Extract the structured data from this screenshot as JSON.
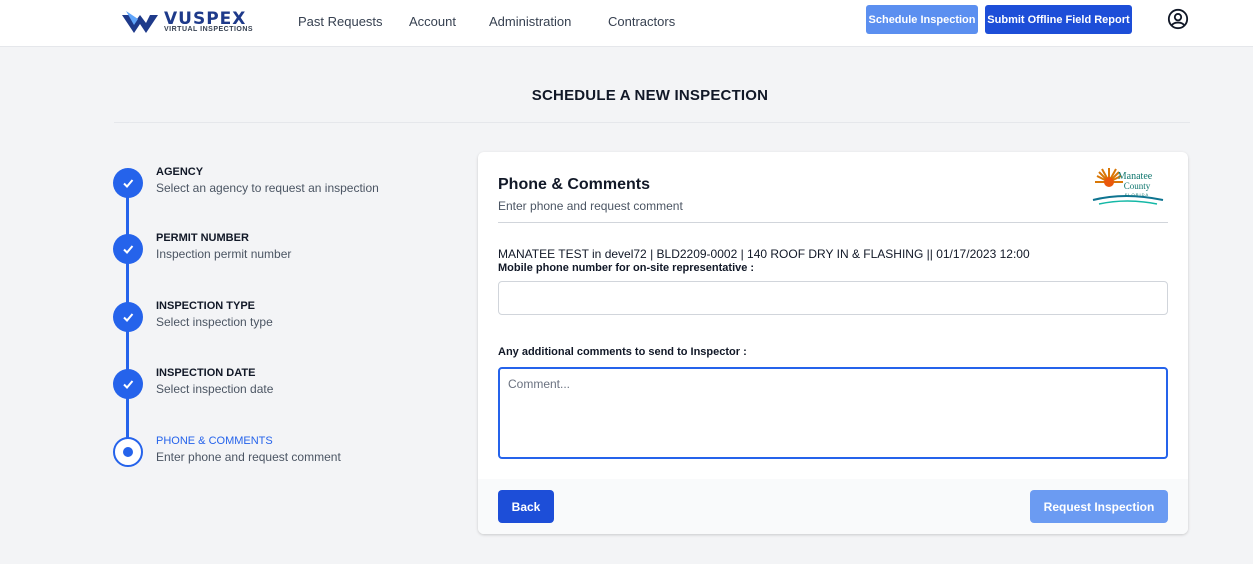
{
  "header": {
    "logo": {
      "wordmark": "VUSPEX",
      "tagline": "VIRTUAL INSPECTIONS"
    },
    "nav": [
      {
        "label": "Past Requests"
      },
      {
        "label": "Account"
      },
      {
        "label": "Administration"
      },
      {
        "label": "Contractors"
      }
    ],
    "schedule_button": "Schedule Inspection",
    "offline_button": "Submit Offline Field Report",
    "user_icon": "user-circle-icon"
  },
  "page_title": "SCHEDULE A NEW INSPECTION",
  "steps": [
    {
      "title": "AGENCY",
      "description": "Select an agency to request an inspection",
      "status": "complete"
    },
    {
      "title": "PERMIT NUMBER",
      "description": "Inspection permit number",
      "status": "complete"
    },
    {
      "title": "INSPECTION TYPE",
      "description": "Select inspection type",
      "status": "complete"
    },
    {
      "title": "INSPECTION DATE",
      "description": "Select inspection date",
      "status": "complete"
    },
    {
      "title": "PHONE & COMMENTS",
      "description": "Enter phone and request comment",
      "status": "current"
    }
  ],
  "form": {
    "title": "Phone & Comments",
    "subtitle": "Enter phone and request comment",
    "agency_logo": {
      "line1": "Manatee",
      "line2": "County",
      "line3": "FLORIDA"
    },
    "permit_info": "MANATEE TEST in devel72 | BLD2209-0002 | 140 ROOF DRY IN & FLASHING || 01/17/2023 12:00",
    "phone_label": "Mobile phone number for on-site representative :",
    "phone_value": "",
    "comments_label": "Any additional comments to send to Inspector :",
    "comments_placeholder": "Comment...",
    "back_button": "Back",
    "request_button": "Request Inspection"
  },
  "colors": {
    "primary": "#1d4ed8",
    "step_blue": "#2563eb",
    "disabled_blue": "#6b9bf2",
    "background": "#f3f4f6"
  }
}
